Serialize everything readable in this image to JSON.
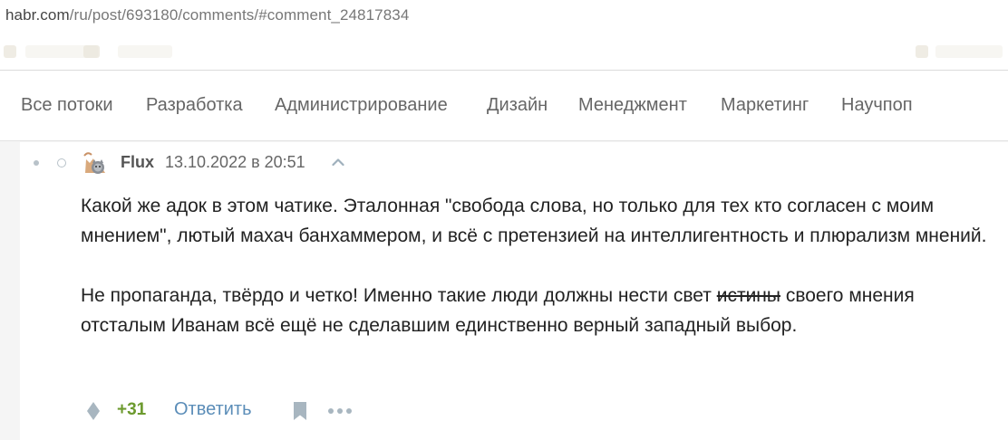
{
  "browser": {
    "url_domain": "habr.com",
    "url_path": "/ru/post/693180/comments/#comment_24817834"
  },
  "nav": {
    "items": [
      "Все потоки",
      "Разработка",
      "Администрирование",
      "Дизайн",
      "Менеджмент",
      "Маркетинг",
      "Научпоп"
    ]
  },
  "comment": {
    "author": "Flux",
    "date": "13.10.2022 в 20:51",
    "avatar_icon": "cat-avatar-icon",
    "paragraph1": "Какой же адок в этом чатике. Эталонная \"свобода слова, но только для тех кто согласен с моим мнением\", лютый махач банхаммером, и всё с претензией на интеллигентность и плюрализм мнений.",
    "paragraph2_before": "Не пропаганда, твёрдо и четко! Именно такие люди должны нести свет ",
    "paragraph2_strike": "истины",
    "paragraph2_after": " своего мнения отсталым Иванам всё ещё не сделавшим единственно верный западный выбор.",
    "score": "+31",
    "reply_label": "Ответить"
  },
  "colors": {
    "score": "#6c9a2e",
    "reply_link": "#5b8db8",
    "icons": "#a8b6c0"
  }
}
